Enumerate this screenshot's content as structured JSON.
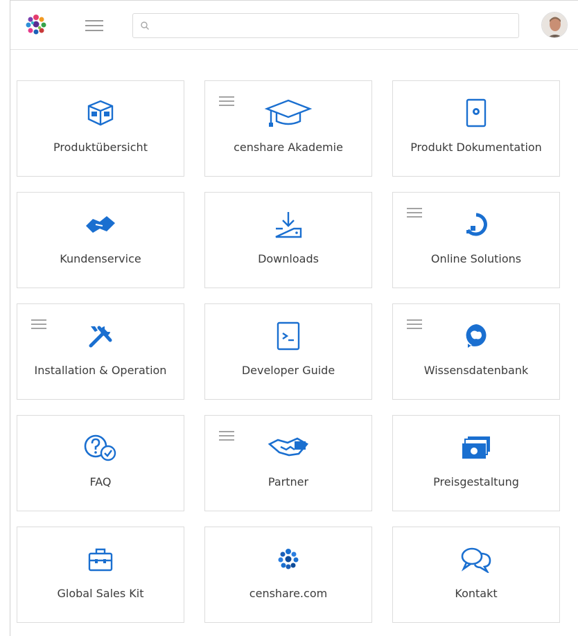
{
  "search": {
    "placeholder": "",
    "value": ""
  },
  "colors": {
    "accent": "#1a6fd0",
    "border": "#dcdcdc"
  },
  "tiles": [
    {
      "label": "Produktübersicht",
      "icon": "box-icon",
      "has_menu": false
    },
    {
      "label": "censhare Akademie",
      "icon": "graduation-cap-icon",
      "has_menu": true
    },
    {
      "label": "Produkt Dokumentation",
      "icon": "document-icon",
      "has_menu": false
    },
    {
      "label": "Kundenservice",
      "icon": "handshake-icon",
      "has_menu": false
    },
    {
      "label": "Downloads",
      "icon": "download-icon",
      "has_menu": false
    },
    {
      "label": "Online Solutions",
      "icon": "cloud-icon",
      "has_menu": true
    },
    {
      "label": "Installation & Operation",
      "icon": "tools-icon",
      "has_menu": true
    },
    {
      "label": "Developer Guide",
      "icon": "terminal-icon",
      "has_menu": false
    },
    {
      "label": "Wissensdatenbank",
      "icon": "brain-icon",
      "has_menu": true
    },
    {
      "label": "FAQ",
      "icon": "question-check-icon",
      "has_menu": false
    },
    {
      "label": "Partner",
      "icon": "partner-handshake-icon",
      "has_menu": true
    },
    {
      "label": "Preisgestaltung",
      "icon": "money-icon",
      "has_menu": false
    },
    {
      "label": "Global Sales Kit",
      "icon": "briefcase-icon",
      "has_menu": false
    },
    {
      "label": "censhare.com",
      "icon": "censhare-logo-icon",
      "has_menu": false
    },
    {
      "label": "Kontakt",
      "icon": "chat-bubbles-icon",
      "has_menu": false
    }
  ]
}
